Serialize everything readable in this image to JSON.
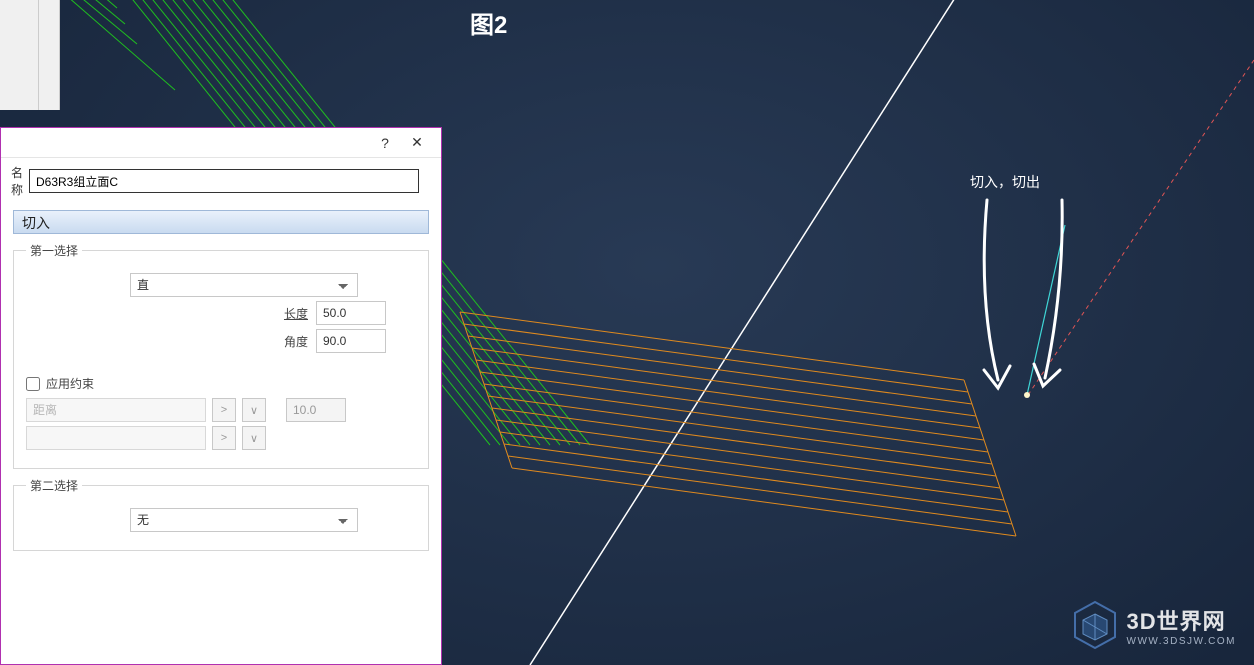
{
  "figure_title": "图2",
  "annotation": "切入，切出",
  "watermark": {
    "name": "3D世界网",
    "domain": "WWW.3DSJW.COM"
  },
  "dialog": {
    "help_symbol": "?",
    "close_symbol": "✕",
    "name_label": "名称",
    "name_value": "D63R3组立面C",
    "section_title": "切入",
    "group1": {
      "legend": "第一选择",
      "mode_value": "直",
      "length_label": "长度",
      "length_value": "50.0",
      "angle_label": "角度",
      "angle_value": "90.0",
      "constraint_check_label": "应用约束",
      "constraint_type": "距离",
      "constraint_value": "10.0",
      "arrow_glyph": ">",
      "caret_glyph": "∨"
    },
    "group2": {
      "legend": "第二选择",
      "mode_value": "无"
    }
  }
}
